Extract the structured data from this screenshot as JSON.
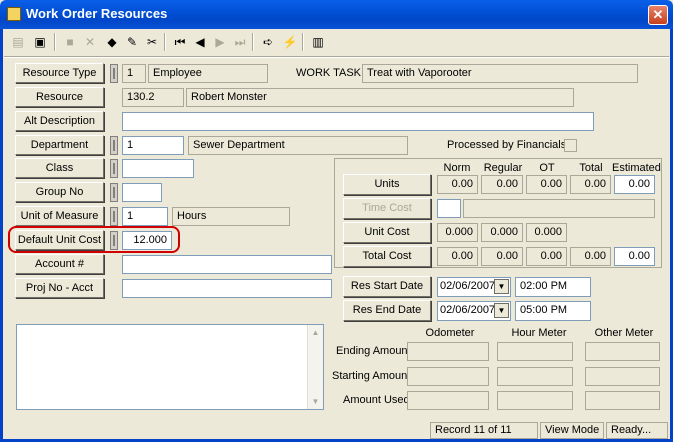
{
  "window": {
    "title": "Work Order Resources",
    "close_glyph": "✕"
  },
  "toolbar": {
    "buttons": [
      {
        "icon": "form-icon",
        "glyph": "▤",
        "enabled": false
      },
      {
        "icon": "copy-form-icon",
        "glyph": "▣",
        "enabled": true
      },
      {
        "icon": "save-icon",
        "glyph": "■",
        "enabled": false
      },
      {
        "icon": "delete-icon",
        "glyph": "✕",
        "enabled": false
      },
      {
        "icon": "records-icon",
        "glyph": "◆",
        "enabled": true
      },
      {
        "icon": "edit-pencil-icon",
        "glyph": "✎",
        "enabled": true
      },
      {
        "icon": "cut-icon",
        "glyph": "✂",
        "enabled": true
      },
      {
        "icon": "first-record-icon",
        "glyph": "⏮",
        "enabled": true
      },
      {
        "icon": "prev-record-icon",
        "glyph": "◀",
        "enabled": true
      },
      {
        "icon": "next-record-icon",
        "glyph": "▶",
        "enabled": false
      },
      {
        "icon": "last-record-icon",
        "glyph": "⏭",
        "enabled": false
      },
      {
        "icon": "go-arrow-icon",
        "glyph": "➪",
        "enabled": true
      },
      {
        "icon": "lightning-icon",
        "glyph": "⚡",
        "enabled": true
      },
      {
        "icon": "report-icon",
        "glyph": "▥",
        "enabled": true
      }
    ]
  },
  "form": {
    "resource_type": {
      "label": "Resource Type",
      "code": "1",
      "desc": "Employee"
    },
    "work_task": {
      "label": "WORK TASK",
      "value": "Treat with Vaporooter"
    },
    "resource": {
      "label": "Resource",
      "code": "130.2",
      "desc": "Robert Monster"
    },
    "alt_description": {
      "label": "Alt Description",
      "value": ""
    },
    "department": {
      "label": "Department",
      "code": "1",
      "desc": "Sewer Department"
    },
    "processed": {
      "label": "Processed by Financials"
    },
    "class": {
      "label": "Class",
      "value": ""
    },
    "group_no": {
      "label": "Group No",
      "value": ""
    },
    "unit_of_measure": {
      "label": "Unit of Measure",
      "code": "1",
      "desc": "Hours"
    },
    "default_unit_cost": {
      "label": "Default Unit Cost",
      "value": "12.000"
    },
    "account": {
      "label": "Account #",
      "value": ""
    },
    "proj_no": {
      "label": "Proj No - Acct",
      "value": ""
    }
  },
  "grid": {
    "columns": [
      "Norm",
      "Regular",
      "OT",
      "Total",
      "Estimated"
    ],
    "rows": {
      "units": {
        "label": "Units",
        "values": [
          "0.00",
          "0.00",
          "0.00",
          "0.00",
          "0.00"
        ]
      },
      "time_cost": {
        "label": "Time Cost"
      },
      "unit_cost": {
        "label": "Unit Cost",
        "values": [
          "0.000",
          "0.000",
          "0.000"
        ]
      },
      "total_cost": {
        "label": "Total Cost",
        "values": [
          "0.00",
          "0.00",
          "0.00",
          "0.00",
          "0.00"
        ]
      }
    }
  },
  "dates": {
    "start": {
      "label": "Res Start Date",
      "date": "02/06/2007",
      "time": "02:00 PM"
    },
    "end": {
      "label": "Res End Date",
      "date": "02/06/2007",
      "time": "05:00 PM"
    }
  },
  "meters": {
    "columns": [
      "Odometer",
      "Hour Meter",
      "Other Meter"
    ],
    "rows": [
      "Ending Amount",
      "Starting Amount",
      "Amount Used"
    ]
  },
  "status": {
    "record": "Record 11 of 11",
    "mode": "View Mode",
    "state": "Ready..."
  },
  "colors": {
    "titlebar": "#0151d7",
    "highlight": "#d00000",
    "background": "#ece9d8"
  }
}
